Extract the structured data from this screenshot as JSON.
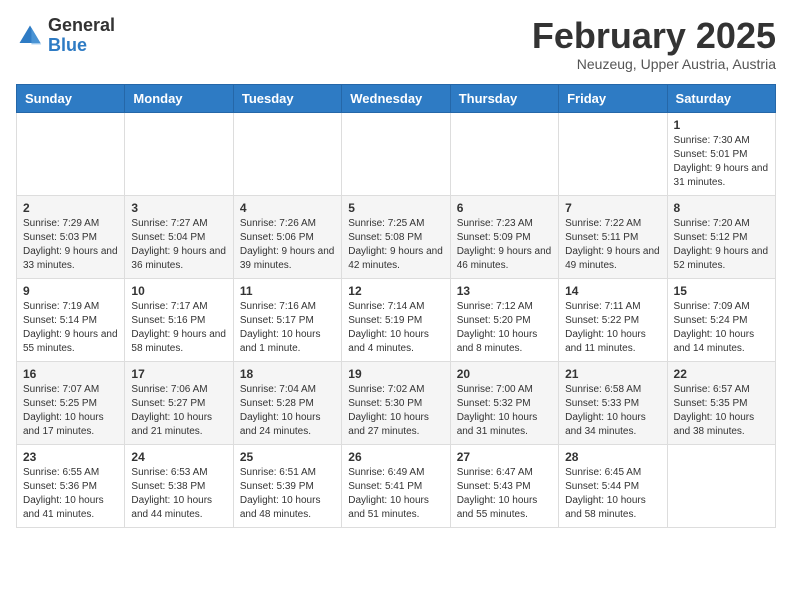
{
  "header": {
    "logo_general": "General",
    "logo_blue": "Blue",
    "month_title": "February 2025",
    "subtitle": "Neuzeug, Upper Austria, Austria"
  },
  "weekdays": [
    "Sunday",
    "Monday",
    "Tuesday",
    "Wednesday",
    "Thursday",
    "Friday",
    "Saturday"
  ],
  "weeks": [
    [
      {
        "day": "",
        "info": ""
      },
      {
        "day": "",
        "info": ""
      },
      {
        "day": "",
        "info": ""
      },
      {
        "day": "",
        "info": ""
      },
      {
        "day": "",
        "info": ""
      },
      {
        "day": "",
        "info": ""
      },
      {
        "day": "1",
        "info": "Sunrise: 7:30 AM\nSunset: 5:01 PM\nDaylight: 9 hours and 31 minutes."
      }
    ],
    [
      {
        "day": "2",
        "info": "Sunrise: 7:29 AM\nSunset: 5:03 PM\nDaylight: 9 hours and 33 minutes."
      },
      {
        "day": "3",
        "info": "Sunrise: 7:27 AM\nSunset: 5:04 PM\nDaylight: 9 hours and 36 minutes."
      },
      {
        "day": "4",
        "info": "Sunrise: 7:26 AM\nSunset: 5:06 PM\nDaylight: 9 hours and 39 minutes."
      },
      {
        "day": "5",
        "info": "Sunrise: 7:25 AM\nSunset: 5:08 PM\nDaylight: 9 hours and 42 minutes."
      },
      {
        "day": "6",
        "info": "Sunrise: 7:23 AM\nSunset: 5:09 PM\nDaylight: 9 hours and 46 minutes."
      },
      {
        "day": "7",
        "info": "Sunrise: 7:22 AM\nSunset: 5:11 PM\nDaylight: 9 hours and 49 minutes."
      },
      {
        "day": "8",
        "info": "Sunrise: 7:20 AM\nSunset: 5:12 PM\nDaylight: 9 hours and 52 minutes."
      }
    ],
    [
      {
        "day": "9",
        "info": "Sunrise: 7:19 AM\nSunset: 5:14 PM\nDaylight: 9 hours and 55 minutes."
      },
      {
        "day": "10",
        "info": "Sunrise: 7:17 AM\nSunset: 5:16 PM\nDaylight: 9 hours and 58 minutes."
      },
      {
        "day": "11",
        "info": "Sunrise: 7:16 AM\nSunset: 5:17 PM\nDaylight: 10 hours and 1 minute."
      },
      {
        "day": "12",
        "info": "Sunrise: 7:14 AM\nSunset: 5:19 PM\nDaylight: 10 hours and 4 minutes."
      },
      {
        "day": "13",
        "info": "Sunrise: 7:12 AM\nSunset: 5:20 PM\nDaylight: 10 hours and 8 minutes."
      },
      {
        "day": "14",
        "info": "Sunrise: 7:11 AM\nSunset: 5:22 PM\nDaylight: 10 hours and 11 minutes."
      },
      {
        "day": "15",
        "info": "Sunrise: 7:09 AM\nSunset: 5:24 PM\nDaylight: 10 hours and 14 minutes."
      }
    ],
    [
      {
        "day": "16",
        "info": "Sunrise: 7:07 AM\nSunset: 5:25 PM\nDaylight: 10 hours and 17 minutes."
      },
      {
        "day": "17",
        "info": "Sunrise: 7:06 AM\nSunset: 5:27 PM\nDaylight: 10 hours and 21 minutes."
      },
      {
        "day": "18",
        "info": "Sunrise: 7:04 AM\nSunset: 5:28 PM\nDaylight: 10 hours and 24 minutes."
      },
      {
        "day": "19",
        "info": "Sunrise: 7:02 AM\nSunset: 5:30 PM\nDaylight: 10 hours and 27 minutes."
      },
      {
        "day": "20",
        "info": "Sunrise: 7:00 AM\nSunset: 5:32 PM\nDaylight: 10 hours and 31 minutes."
      },
      {
        "day": "21",
        "info": "Sunrise: 6:58 AM\nSunset: 5:33 PM\nDaylight: 10 hours and 34 minutes."
      },
      {
        "day": "22",
        "info": "Sunrise: 6:57 AM\nSunset: 5:35 PM\nDaylight: 10 hours and 38 minutes."
      }
    ],
    [
      {
        "day": "23",
        "info": "Sunrise: 6:55 AM\nSunset: 5:36 PM\nDaylight: 10 hours and 41 minutes."
      },
      {
        "day": "24",
        "info": "Sunrise: 6:53 AM\nSunset: 5:38 PM\nDaylight: 10 hours and 44 minutes."
      },
      {
        "day": "25",
        "info": "Sunrise: 6:51 AM\nSunset: 5:39 PM\nDaylight: 10 hours and 48 minutes."
      },
      {
        "day": "26",
        "info": "Sunrise: 6:49 AM\nSunset: 5:41 PM\nDaylight: 10 hours and 51 minutes."
      },
      {
        "day": "27",
        "info": "Sunrise: 6:47 AM\nSunset: 5:43 PM\nDaylight: 10 hours and 55 minutes."
      },
      {
        "day": "28",
        "info": "Sunrise: 6:45 AM\nSunset: 5:44 PM\nDaylight: 10 hours and 58 minutes."
      },
      {
        "day": "",
        "info": ""
      }
    ]
  ]
}
